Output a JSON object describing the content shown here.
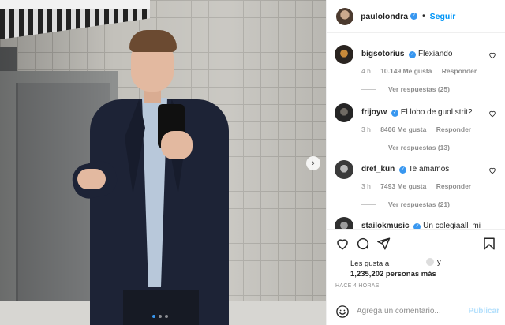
{
  "post": {
    "carousel": {
      "slides": 3,
      "active": 1
    }
  },
  "header": {
    "username": "paulolondra",
    "separator": "•",
    "follow_label": "Seguir"
  },
  "comments": [
    {
      "username": "bigsotorius",
      "verified": true,
      "text": "Flexiando",
      "time": "4 h",
      "likes": "10.149 Me gusta",
      "reply": "Responder",
      "view_replies": "Ver respuestas (25)"
    },
    {
      "username": "frijoyw",
      "verified": true,
      "text": "El lobo de guol strit?",
      "time": "3 h",
      "likes": "8406 Me gusta",
      "reply": "Responder",
      "view_replies": "Ver respuestas (13)"
    },
    {
      "username": "dref_kun",
      "verified": true,
      "text": "Te amamos",
      "time": "3 h",
      "likes": "7493 Me gusta",
      "reply": "Responder",
      "view_replies": "Ver respuestas (21)"
    },
    {
      "username": "stailokmusic",
      "verified": true,
      "text": "Un colegiaalll mi"
    }
  ],
  "likes": {
    "prefix": "Les gusta a",
    "and": "y",
    "count_text": "1,235,202 personas más"
  },
  "timestamp": "HACE 4 HORAS",
  "add_comment": {
    "placeholder": "Agrega un comentario...",
    "publish_label": "Publicar"
  },
  "colors": {
    "accent": "#0095f6",
    "verified": "#3897f0",
    "publish_disabled": "#b2dffc",
    "muted": "#8e8e8e"
  },
  "icons": [
    "more-options-icon",
    "heart-icon",
    "comment-icon",
    "share-icon",
    "bookmark-icon",
    "emoji-icon",
    "chevron-right-icon",
    "verified-icon"
  ]
}
